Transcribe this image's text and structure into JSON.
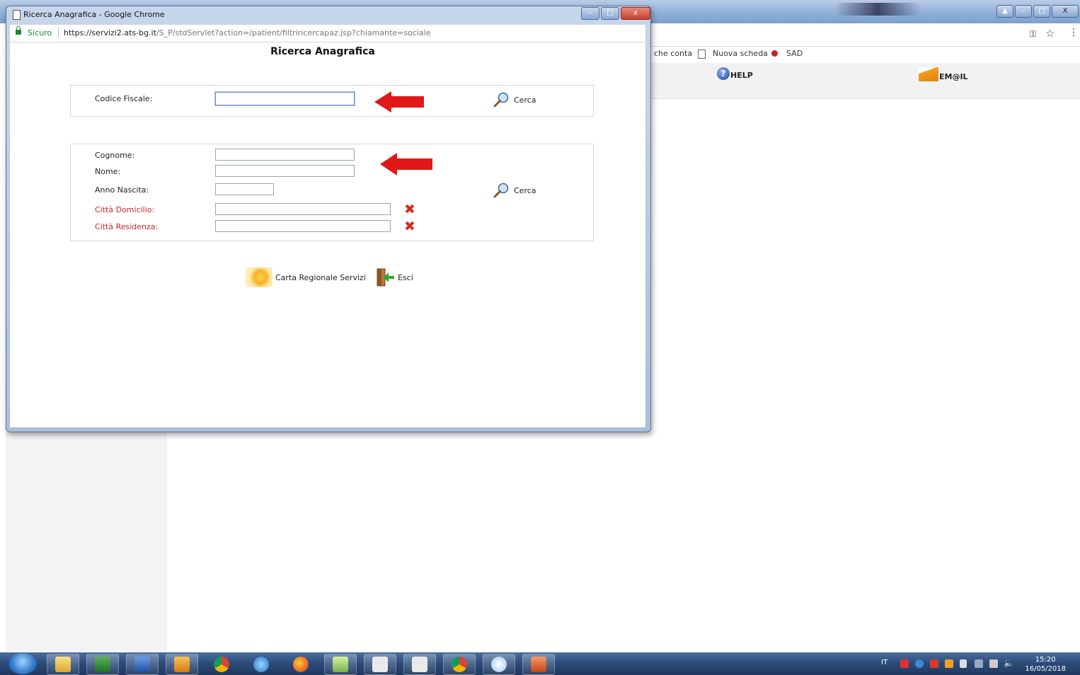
{
  "background": {
    "bookmarks": [
      "che conta",
      "Nuova scheda",
      "SAD"
    ],
    "nav": {
      "help": "HELP",
      "email": "EM@IL"
    }
  },
  "popup": {
    "window_title": "Ricerca Anagrafica - Google Chrome",
    "address": {
      "secure_label": "Sicuro",
      "url_host": "https://servizi2.ats-bg.it",
      "url_path": "/S_P/stdServlet?action=/patient/filtriricercapaz.jsp?chiamante=sociale"
    },
    "heading": "Ricerca Anagrafica",
    "codice_fiscale": {
      "label": "Codice Fiscale:",
      "value": ""
    },
    "search_label": "Cerca",
    "cognome": {
      "label": "Cognome:",
      "value": ""
    },
    "nome": {
      "label": "Nome:",
      "value": ""
    },
    "anno_nascita": {
      "label": "Anno Nascita:",
      "value": ""
    },
    "citta_domicilio": {
      "label": "Città Domicilio:",
      "value": ""
    },
    "citta_residenza": {
      "label": "Città Residenza:",
      "value": ""
    },
    "actions": {
      "crs": "Carta Regionale Servizi",
      "exit": "Esci"
    }
  },
  "taskbar": {
    "language": "IT",
    "time": "15:20",
    "date": "16/05/2018"
  },
  "colors": {
    "required_label": "#c0282a",
    "arrow": "#e01818",
    "clear": "#d42c20"
  }
}
